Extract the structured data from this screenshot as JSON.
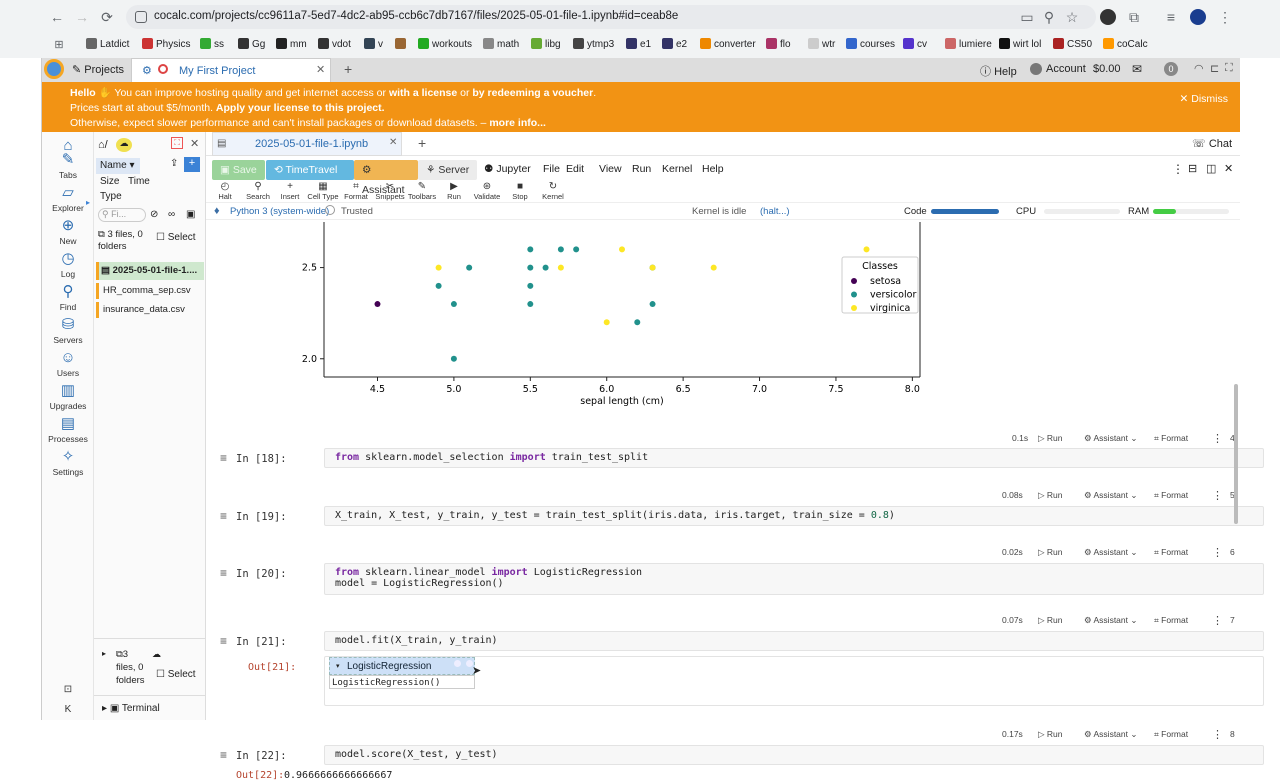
{
  "browser": {
    "url": "cocalc.com/projects/cc9611a7-5ed7-4dc2-ab95-ccb6c7db7167/files/2025-05-01-file-1.ipynb#id=ceab8e",
    "bookmarks": [
      "Latdict",
      "Physics",
      "ss",
      "Gg",
      "mm",
      "vdot",
      "v",
      "",
      "workouts",
      "math",
      "libg",
      "ytmp3",
      "e1",
      "e2",
      "converter",
      "flo",
      "wtr",
      "courses",
      "cv",
      "lumiere",
      "wirt lol",
      "CS50",
      "coCalc"
    ]
  },
  "app": {
    "projects_label": "Projects",
    "project_tab": "My First Project",
    "help": "Help",
    "account": "Account",
    "balance": "$0.00",
    "notif_count": "0"
  },
  "banner": {
    "hello": "Hello",
    "l1a": " You can improve hosting quality and get internet access or ",
    "l1b": "with a license",
    "l1c": " or ",
    "l1d": "by redeeming a voucher",
    "l1e": ".",
    "l2a": "Prices start at about $5/month. ",
    "l2b": "Apply your license to this project.",
    "l3a": "Otherwise, expect slower performance and can't install packages or download datasets. – ",
    "l3b": "more info...",
    "dismiss": "Dismiss"
  },
  "leftnav": [
    "Tabs",
    "Explorer",
    "New",
    "Log",
    "Find",
    "Servers",
    "Users",
    "Upgrades",
    "Processes",
    "Settings"
  ],
  "files": {
    "sort_name": "Name",
    "sort_size": "Size",
    "sort_time": "Time",
    "sort_type": "Type",
    "filter_placeholder": "Fi...",
    "summary": "3 files, 0 folders",
    "select": "Select",
    "items": [
      "2025-05-01-file-1....",
      "HR_comma_sep.csv",
      "insurance_data.csv"
    ],
    "bottom_summary_a": "3",
    "bottom_summary_b": "files, 0",
    "bottom_summary_c": "folders",
    "bottom_select": "Select",
    "terminal": "Terminal"
  },
  "notebook": {
    "tab": "2025-05-01-file-1.ipynb",
    "chat": "Chat",
    "buttons": {
      "save": "Save",
      "timetravel": "TimeTravel",
      "assistant": "Assistant",
      "server": "Server"
    },
    "menus": [
      "Jupyter",
      "File",
      "Edit",
      "View",
      "Run",
      "Kernel",
      "Help"
    ],
    "tools": [
      "Halt",
      "Search",
      "Insert",
      "Cell Type",
      "Format",
      "Snippets",
      "Toolbars",
      "Run",
      "Validate",
      "Stop",
      "Kernel"
    ],
    "kernel": "Python 3 (system-wide)",
    "trusted": "Trusted",
    "kernel_status": "Kernel is idle",
    "halt": "(halt...)",
    "code": "Code",
    "cpu": "CPU",
    "ram": "RAM",
    "code_level": 1.0,
    "cpu_level": 0.0,
    "ram_level": 0.3
  },
  "plot": {
    "xlabel": "sepal length (cm)",
    "xticks": [
      "4.5",
      "5.0",
      "5.5",
      "6.0",
      "6.5",
      "7.0",
      "7.5",
      "8.0"
    ],
    "yticks": [
      "2.5",
      "2.0"
    ],
    "legend_title": "Classes",
    "legend": [
      "setosa",
      "versicolor",
      "virginica"
    ]
  },
  "chart_data": {
    "type": "scatter",
    "xlabel": "sepal length (cm)",
    "xlim": [
      4.15,
      8.05
    ],
    "ylim": [
      1.9,
      2.75
    ],
    "series": [
      {
        "name": "setosa",
        "color": "#440154",
        "points": [
          [
            4.5,
            2.3
          ]
        ]
      },
      {
        "name": "versicolor",
        "color": "#21918c",
        "points": [
          [
            4.9,
            2.4
          ],
          [
            5.0,
            2.3
          ],
          [
            5.0,
            2.0
          ],
          [
            5.1,
            2.5
          ],
          [
            5.5,
            2.5
          ],
          [
            5.5,
            2.4
          ],
          [
            5.5,
            2.3
          ],
          [
            5.6,
            2.5
          ],
          [
            6.2,
            2.2
          ],
          [
            6.3,
            2.5
          ],
          [
            6.3,
            2.3
          ],
          [
            5.5,
            2.6
          ],
          [
            5.7,
            2.6
          ],
          [
            5.8,
            2.6
          ]
        ]
      },
      {
        "name": "virginica",
        "color": "#fde725",
        "points": [
          [
            4.9,
            2.5
          ],
          [
            5.7,
            2.5
          ],
          [
            6.0,
            2.2
          ],
          [
            6.3,
            2.5
          ],
          [
            6.7,
            2.5
          ],
          [
            6.1,
            2.6
          ],
          [
            7.7,
            2.6
          ]
        ]
      }
    ]
  },
  "cells": [
    {
      "prompt": "In [18]:",
      "time": "0.1s",
      "num": "4",
      "code": [
        [
          [
            "kw",
            "from"
          ],
          [
            "t",
            " sklearn.model_selection "
          ],
          [
            "kw",
            "import"
          ],
          [
            "t",
            " train_test_split"
          ]
        ]
      ]
    },
    {
      "prompt": "In [19]:",
      "time": "0.08s",
      "num": "5",
      "code": [
        [
          [
            "t",
            "X_train, X_test, y_train, y_test = train_test_split(iris.data, iris.target, train_size = "
          ],
          [
            "num",
            "0.8"
          ],
          [
            "t",
            ")"
          ]
        ]
      ]
    },
    {
      "prompt": "In [20]:",
      "time": "0.02s",
      "num": "6",
      "code": [
        [
          [
            "kw",
            "from"
          ],
          [
            "t",
            " sklearn.linear_model "
          ],
          [
            "kw",
            "import"
          ],
          [
            "t",
            " LogisticRegression"
          ]
        ],
        [
          [
            "t",
            "model = LogisticRegression()"
          ]
        ]
      ]
    },
    {
      "prompt": "In [21]:",
      "time": "0.07s",
      "num": "7",
      "code": [
        [
          [
            "t",
            "model.fit(X_train, y_train)"
          ]
        ]
      ]
    },
    {
      "prompt": "In [22]:",
      "time": "0.17s",
      "num": "8",
      "code": [
        [
          [
            "t",
            "model.score(X_test, y_test)"
          ]
        ]
      ]
    }
  ],
  "cell_actions": {
    "run": "Run",
    "assistant": "Assistant",
    "format": "Format"
  },
  "out21": {
    "prompt": "Out[21]:",
    "title": "LogisticRegression",
    "repr": "LogisticRegression()"
  },
  "out22": {
    "prompt": "Out[22]:",
    "value": "0.9666666666666667"
  }
}
